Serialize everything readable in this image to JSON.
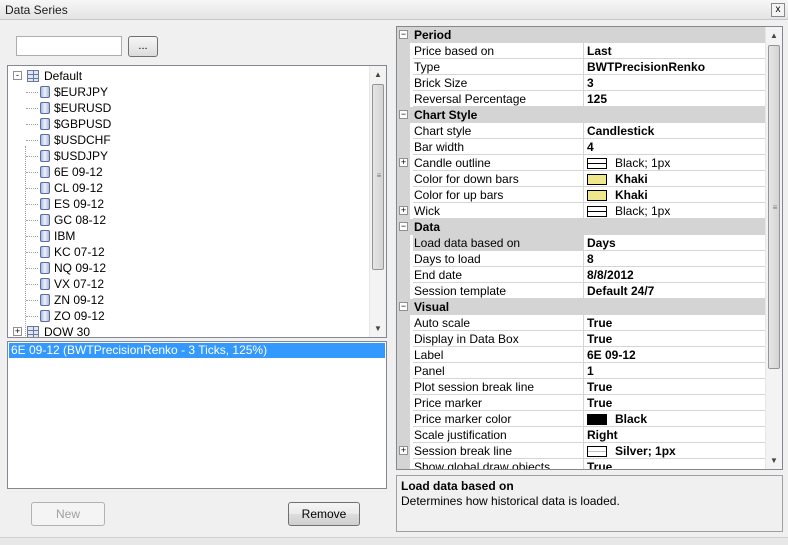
{
  "window": {
    "title": "Data Series",
    "close_glyph": "x"
  },
  "search": {
    "value": "",
    "browse_label": "..."
  },
  "tree": {
    "root": "Default",
    "items": [
      "$EURJPY",
      "$EURUSD",
      "$GBPUSD",
      "$USDCHF",
      "$USDJPY",
      "6E 09-12",
      "CL 09-12",
      "ES 09-12",
      "GC 08-12",
      "IBM",
      "KC 07-12",
      "NQ 09-12",
      "VX 07-12",
      "ZN 09-12",
      "ZO 09-12"
    ],
    "next_root": "DOW 30",
    "expander_glyph": "-",
    "collapsed_glyph": "+"
  },
  "series_list": {
    "items": [
      "6E 09-12 (BWTPrecisionRenko - 3 Ticks, 125%)"
    ]
  },
  "buttons": {
    "new": "New",
    "remove": "Remove"
  },
  "properties": {
    "period": {
      "title": "Period",
      "rows": [
        {
          "label": "Price based on",
          "value": "Last"
        },
        {
          "label": "Type",
          "value": "BWTPrecisionRenko"
        },
        {
          "label": "Brick Size",
          "value": "3"
        },
        {
          "label": "Reversal Percentage",
          "value": "125"
        }
      ]
    },
    "chart_style": {
      "title": "Chart Style",
      "rows": [
        {
          "label": "Chart style",
          "value": "Candlestick"
        },
        {
          "label": "Bar width",
          "value": "4"
        },
        {
          "label": "Candle outline",
          "value": "Black; 1px"
        },
        {
          "label": "Color for down bars",
          "value": "Khaki"
        },
        {
          "label": "Color for up bars",
          "value": "Khaki"
        },
        {
          "label": "Wick",
          "value": "Black; 1px"
        }
      ]
    },
    "data": {
      "title": "Data",
      "rows": [
        {
          "label": "Load data based on",
          "value": "Days"
        },
        {
          "label": "Days to load",
          "value": "8"
        },
        {
          "label": "End date",
          "value": "8/8/2012"
        },
        {
          "label": "Session template",
          "value": "Default 24/7"
        }
      ]
    },
    "visual": {
      "title": "Visual",
      "rows": [
        {
          "label": "Auto scale",
          "value": "True"
        },
        {
          "label": "Display in Data Box",
          "value": "True"
        },
        {
          "label": "Label",
          "value": "6E 09-12"
        },
        {
          "label": "Panel",
          "value": "1"
        },
        {
          "label": "Plot session break line",
          "value": "True"
        },
        {
          "label": "Price marker",
          "value": "True"
        },
        {
          "label": "Price marker color",
          "value": "Black"
        },
        {
          "label": "Scale justification",
          "value": "Right"
        },
        {
          "label": "Session break line",
          "value": "Silver; 1px"
        },
        {
          "label": "Show global draw objects",
          "value": "True"
        }
      ]
    }
  },
  "colors": {
    "khaki": "#f0e68c",
    "black": "#000000",
    "silver": "#c0c0c0",
    "selection": "#3399ff"
  },
  "description": {
    "title": "Load data based on",
    "text": "Determines how historical data is loaded."
  }
}
